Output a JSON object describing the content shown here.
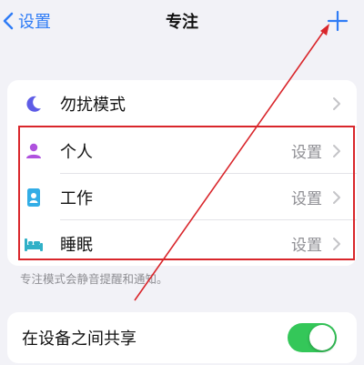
{
  "nav": {
    "back_label": "设置",
    "title": "专注",
    "add_icon": "plus-icon"
  },
  "focus_modes": [
    {
      "label": "勿扰模式",
      "value": "",
      "icon": "moon-icon",
      "color": "#5e5ce6"
    },
    {
      "label": "个人",
      "value": "设置",
      "icon": "person-icon",
      "color": "#af52de"
    },
    {
      "label": "工作",
      "value": "设置",
      "icon": "id-badge-icon",
      "color": "#32ade6"
    },
    {
      "label": "睡眠",
      "value": "设置",
      "icon": "bed-icon",
      "color": "#30b0c7"
    }
  ],
  "footnote": "专注模式会静音提醒和通知。",
  "share": {
    "label": "在设备之间共享",
    "enabled": true
  },
  "colors": {
    "accent": "#2f7cf6",
    "toggle_on": "#34c759",
    "annotation": "#d9262b"
  }
}
